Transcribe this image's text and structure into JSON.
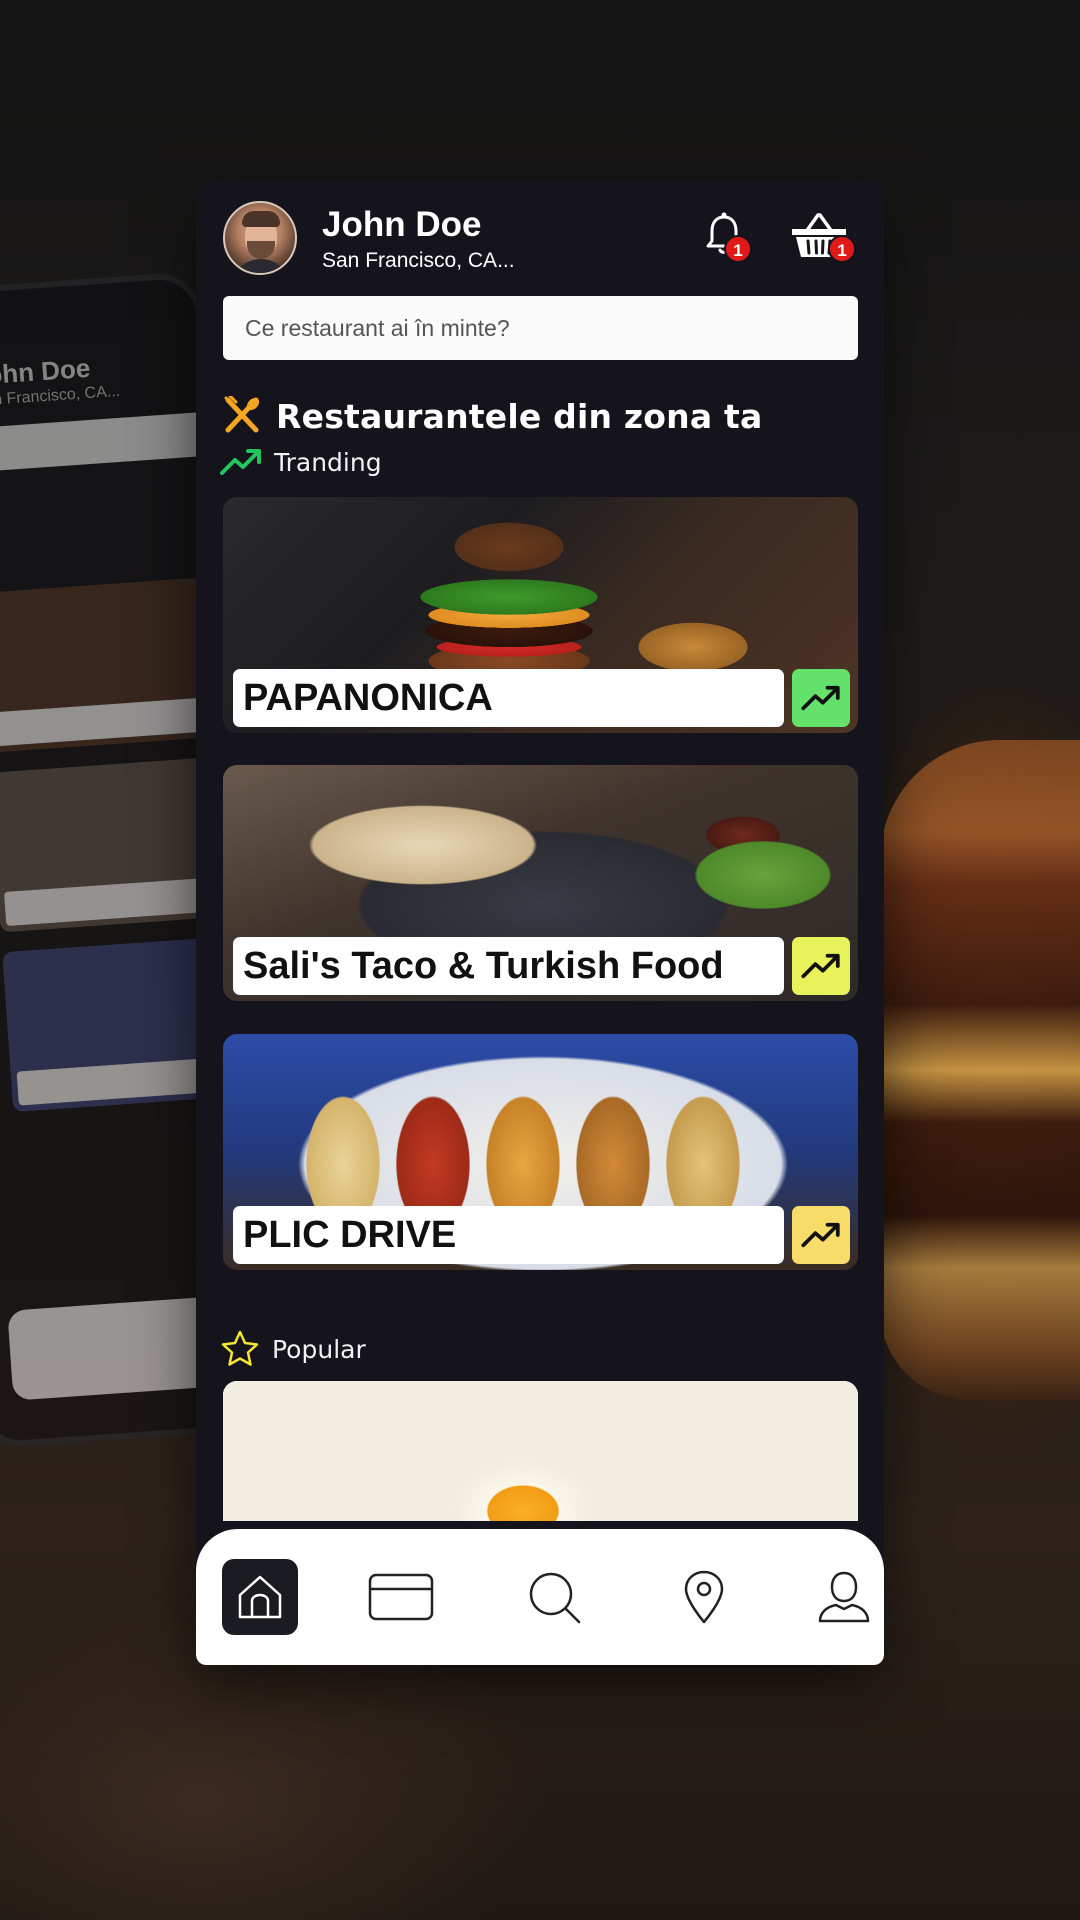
{
  "user": {
    "name": "John Doe",
    "location": "San Francisco, CA..."
  },
  "notifications": {
    "badge_count": "1",
    "icon": "bell-icon"
  },
  "cart": {
    "badge_count": "1",
    "icon": "basket-icon"
  },
  "search": {
    "placeholder": "Ce restaurant ai în minte?"
  },
  "section": {
    "title": "Restaurantele din zona ta",
    "icon": "fork-knife-icon",
    "icon_color": "#f4a623"
  },
  "trending": {
    "label": "Tranding",
    "icon": "trending-up-icon",
    "icon_color": "#22c55e"
  },
  "restaurants": [
    {
      "name": "PAPANONICA",
      "trend_color": "#63e16a"
    },
    {
      "name": "Sali's Taco & Turkish Food",
      "trend_color": "#e8f25a"
    },
    {
      "name": "PLIC DRIVE",
      "trend_color": "#f7dc6a"
    }
  ],
  "popular": {
    "label": "Popular",
    "icon": "star-icon",
    "icon_color": "#f5e633"
  },
  "bottom_nav": {
    "items": [
      "home-icon",
      "card-icon",
      "search-icon",
      "location-pin-icon",
      "user-icon"
    ],
    "active": "home-icon"
  },
  "colors": {
    "background": "#15131c",
    "nav_background": "#ffffff",
    "badge": "#e01919"
  }
}
